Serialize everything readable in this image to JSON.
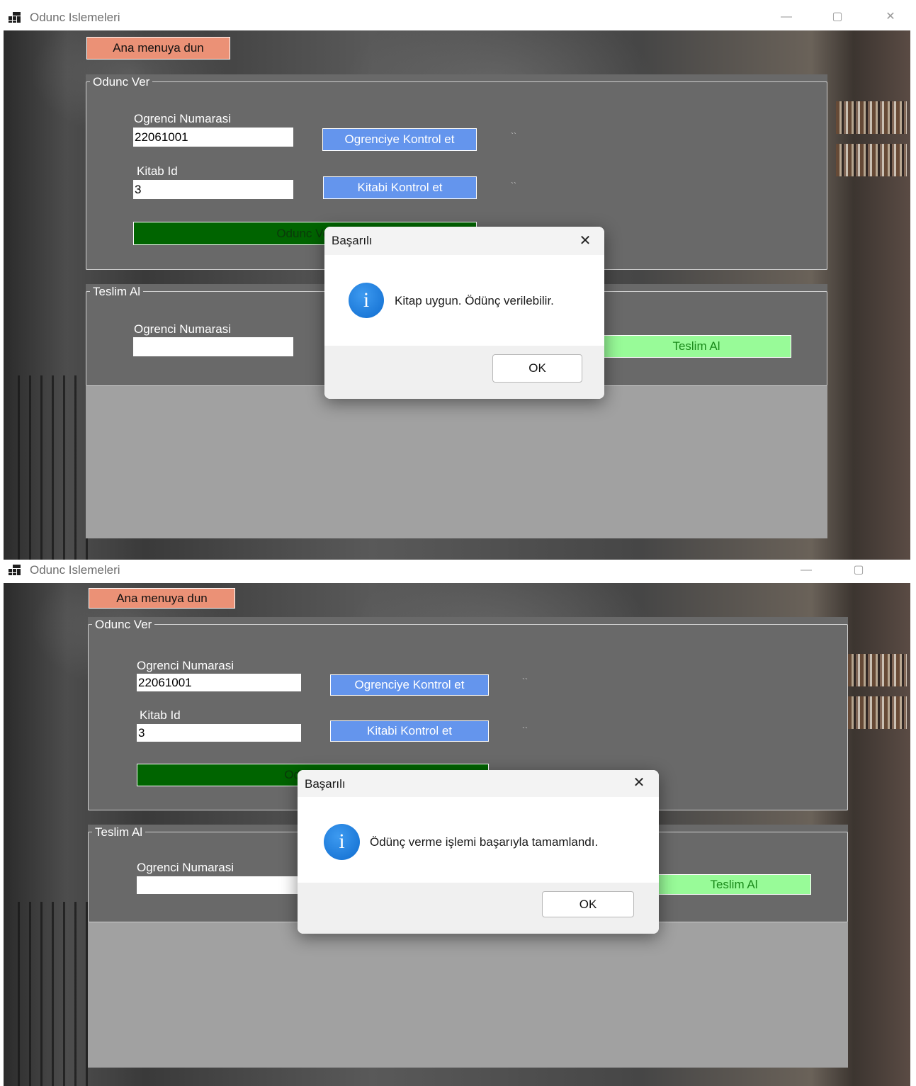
{
  "window": {
    "title": "Odunc Islemeleri",
    "controls": {
      "minimize": "—",
      "maximize": "▢",
      "close": "✕"
    }
  },
  "main": {
    "back_button": "Ana menuya dun",
    "lend_group": {
      "legend": "Odunc Ver",
      "student_label": "Ogrenci Numarasi",
      "student_value": "22061001",
      "check_student_button": "Ogrenciye Kontrol et",
      "student_status": "``",
      "book_label": "Kitab Id",
      "book_value": "3",
      "check_book_button": "Kitabi Kontrol et",
      "book_status": "``",
      "lend_button": "Odunc Ver"
    },
    "return_group": {
      "legend": "Teslim Al",
      "student_label": "Ogrenci Numarasi",
      "student_value": "",
      "return_button": "Teslim Al"
    }
  },
  "dialogs": [
    {
      "title": "Başarılı",
      "message": "Kitap uygun. Ödünç verilebilir.",
      "ok": "OK",
      "close": "✕",
      "icon": "info-icon"
    },
    {
      "title": "Başarılı",
      "message": "Ödünç verme işlemi başarıyla tamamlandı.",
      "ok": "OK",
      "close": "✕",
      "icon": "info-icon"
    }
  ],
  "colors": {
    "menu_button": "#eb9176",
    "check_button": "#6495ed",
    "lend_button": "#006400",
    "return_button": "#98fb98",
    "group_background": "#696969",
    "lower_panel": "#a1a1a1"
  }
}
